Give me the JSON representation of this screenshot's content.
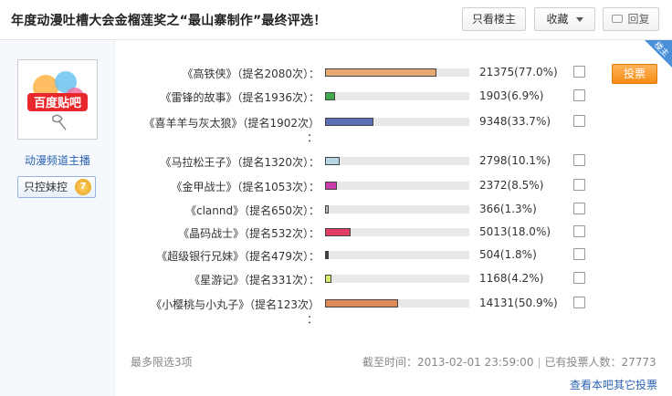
{
  "header": {
    "title": "年度动漫吐槽大会金榴莲奖之“最山寨制作”最终评选！",
    "only_host_label": "只看楼主",
    "favorite_label": "收藏",
    "reply_label": "回复"
  },
  "author": {
    "avatar_text": "百度贴吧",
    "name": "动漫频道主播",
    "badge_label": "只控妹控",
    "badge_level": "7"
  },
  "ribbon_label": "楼主",
  "vote_button_label": "投票",
  "candidates": [
    {
      "label": "《高铁侠》（提名2080次）：",
      "count": "21375(77.0%)",
      "percent": 77.0,
      "color": "#e8a872",
      "wrap": false
    },
    {
      "label": "《雷锋的故事》（提名1936次）：",
      "count": "1903(6.9%)",
      "percent": 6.9,
      "color": "#3fa84a",
      "wrap": false
    },
    {
      "label": "《喜羊羊与灰太狼》（提名1902次）",
      "count": "9348(33.7%)",
      "percent": 33.7,
      "color": "#5a6fb4",
      "wrap": true
    },
    {
      "label": "《马拉松王子》（提名1320次）：",
      "count": "2798(10.1%)",
      "percent": 10.1,
      "color": "#b6d7e6",
      "wrap": false
    },
    {
      "label": "《金甲战士》（提名1053次）：",
      "count": "2372(8.5%)",
      "percent": 8.5,
      "color": "#c83ca8",
      "wrap": false
    },
    {
      "label": "《clannd》（提名650次）：",
      "count": "366(1.3%)",
      "percent": 1.3,
      "color": "#b8b8b8",
      "wrap": false
    },
    {
      "label": "《晶码战士》（提名532次）：",
      "count": "5013(18.0%)",
      "percent": 18.0,
      "color": "#e23c64",
      "wrap": false
    },
    {
      "label": "《超级银行兄妹》（提名479次）：",
      "count": "504(1.8%)",
      "percent": 1.8,
      "color": "#3a3a3a",
      "wrap": false
    },
    {
      "label": "《星游记》（提名331次）：",
      "count": "1168(4.2%)",
      "percent": 4.2,
      "color": "#d8e86a",
      "wrap": false
    },
    {
      "label": "《小樱桃与小丸子》（提名123次）",
      "count": "14131(50.9%)",
      "percent": 50.9,
      "color": "#e08a5a",
      "wrap": true
    }
  ],
  "footer": {
    "limit_text": "最多限选3项",
    "deadline_label": "截至时间：2013-02-01 23:59:00",
    "voters_label": "已有投票人数：",
    "voters_count": "27773",
    "more_link": "查看本吧其它投票",
    "separator": "|"
  },
  "colors": {
    "accent": "#2d64b3",
    "vote_button": "#f58c14",
    "ribbon": "#4a90d9"
  }
}
